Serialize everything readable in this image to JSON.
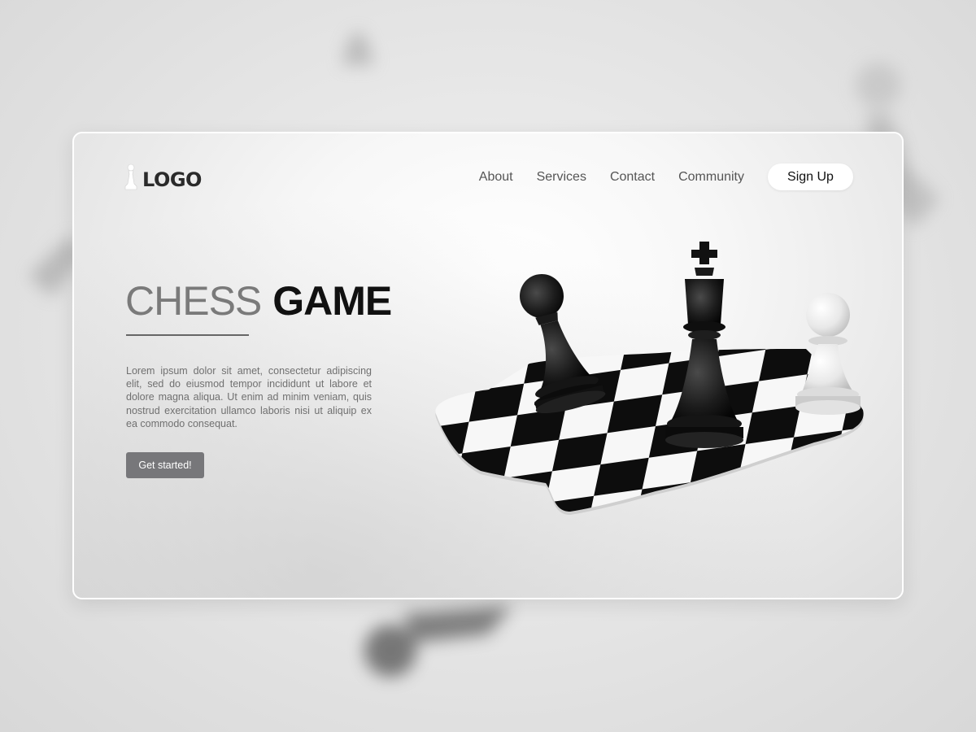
{
  "brand": {
    "logo_text": "LOGO"
  },
  "nav": {
    "items": [
      {
        "label": "About"
      },
      {
        "label": "Services"
      },
      {
        "label": "Contact"
      },
      {
        "label": "Community"
      }
    ],
    "signup_label": "Sign Up"
  },
  "hero": {
    "title_light": "CHESS",
    "title_bold": "GAME",
    "body": "Lorem ipsum dolor sit amet, consectetur adipiscing elit, sed do eiusmod tempor incididunt ut labore et dolore magna aliqua. Ut enim ad minim veniam, quis nostrud exercitation ullamco laboris nisi ut aliquip ex ea commodo consequat.",
    "cta_label": "Get started!"
  },
  "illustration": {
    "pieces": [
      "black-pawn",
      "black-king",
      "white-pawn"
    ],
    "board": "checkered-melting-board"
  },
  "colors": {
    "cta_bg": "#77777a",
    "title_light": "#7a7a7a",
    "title_bold": "#111111",
    "nav_text": "#555555"
  }
}
